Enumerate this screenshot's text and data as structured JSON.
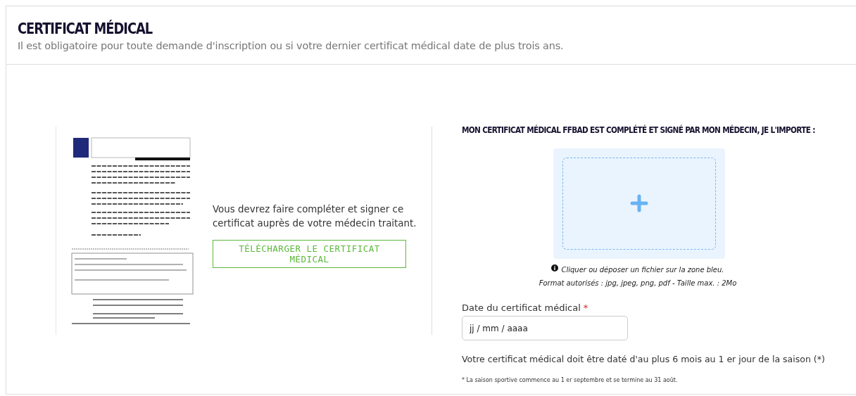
{
  "header": {
    "title": "CERTIFICAT MÉDICAL",
    "subtitle": "Il est obligatoire pour toute demande d'inscription ou si votre dernier certificat médical date de plus trois ans."
  },
  "download": {
    "instructions": "Vous devrez faire compléter et signer ce certificat auprès de votre médecin traitant.",
    "button": "TÉLÉCHARGER LE CERTIFICAT MÉDICAL"
  },
  "upload": {
    "title": "MON CERTIFICAT MÉDICAL FFBAD EST COMPLÉTÉ ET SIGNÉ PAR MON MÉDECIN, JE L'IMPORTE :",
    "hint": "Cliquer ou déposer un fichier sur la zone bleu.",
    "formats": "Format autorisés : jpg, jpeg, png, pdf - Taille max. : 2Mo"
  },
  "date_field": {
    "label": "Date du certificat médical",
    "required": true,
    "required_mark": "*",
    "placeholder": "jj / mm / aaaa"
  },
  "note": "Votre certificat médical doit être daté d'au plus 6 mois au 1 er jour de la saison (*)",
  "footnote": "* La saison sportive commence au 1 er septembre et se termine au 31 août."
}
